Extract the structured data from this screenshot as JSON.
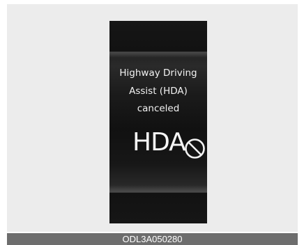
{
  "display": {
    "message_lines": [
      "Highway Driving",
      "Assist (HDA)",
      "canceled"
    ],
    "indicator_label": "HDA",
    "indicator_status_icon": "cancel-icon"
  },
  "figure": {
    "caption": "ODL3A050280"
  },
  "colors": {
    "frame_background": "#ececec",
    "display_background": "#141414",
    "text": "#f2f2f2",
    "caption_bar": "#6d6d6d"
  }
}
